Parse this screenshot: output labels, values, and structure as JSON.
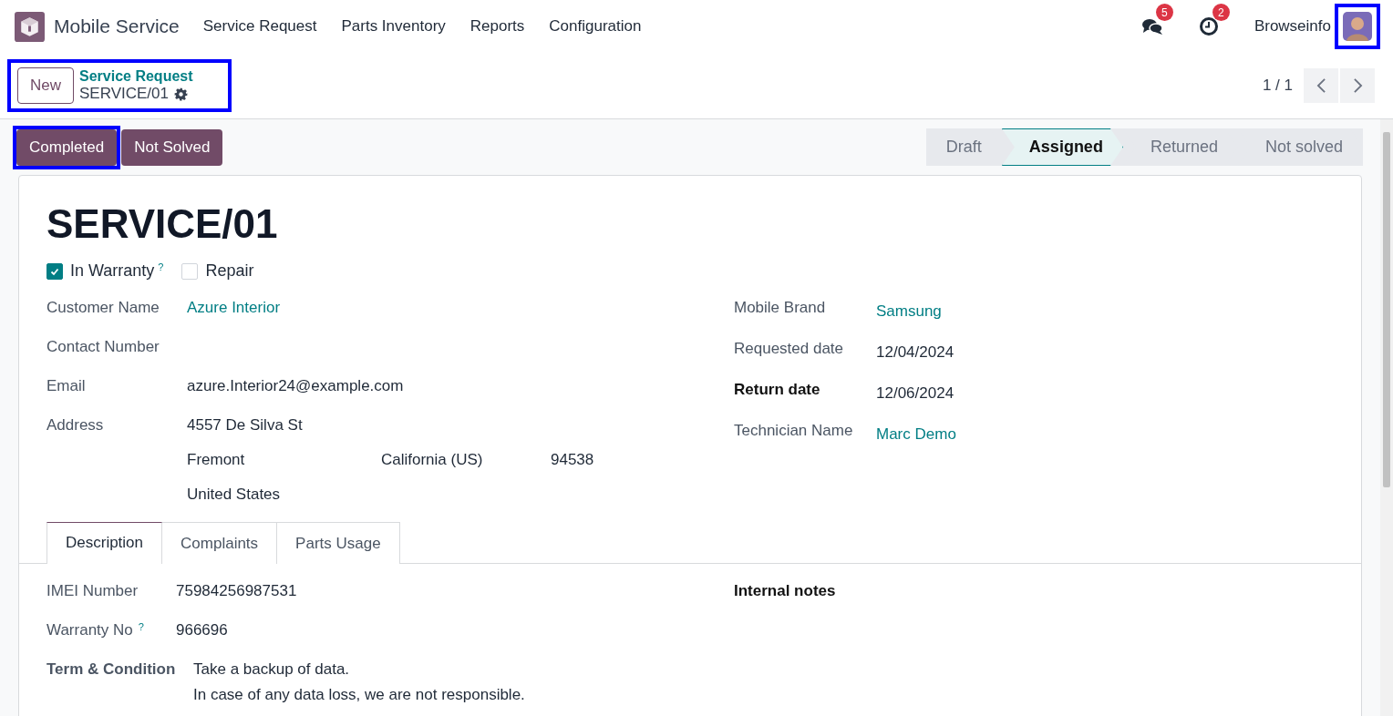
{
  "navbar": {
    "app_name": "Mobile Service",
    "menu": [
      "Service Request",
      "Parts Inventory",
      "Reports",
      "Configuration"
    ],
    "systray": [
      {
        "kind": "messages",
        "badge": "5"
      },
      {
        "kind": "activities",
        "badge": "2"
      }
    ],
    "company": "Browseinfo",
    "avatar": {
      "highlighted": true
    }
  },
  "control_panel": {
    "new_button": "New",
    "breadcrumb": "Service Request",
    "record": "SERVICE/01",
    "highlighted": true,
    "pager": "1 / 1"
  },
  "actions": [
    {
      "label": "Completed",
      "highlighted": true
    },
    {
      "label": "Not Solved",
      "highlighted": false
    }
  ],
  "status_bar": [
    {
      "label": "Draft",
      "selected": false
    },
    {
      "label": "Assigned",
      "selected": true
    },
    {
      "label": "Returned",
      "selected": false
    },
    {
      "label": "Not solved",
      "selected": false
    }
  ],
  "form": {
    "title": "SERVICE/01",
    "checkboxes": [
      {
        "label": "In Warranty",
        "checked": true,
        "help": "?"
      },
      {
        "label": "Repair",
        "checked": false
      }
    ],
    "left_fields": [
      {
        "label": "Customer Name",
        "kind": "link",
        "required": false,
        "value": "Azure Interior"
      },
      {
        "label": "Contact Number",
        "kind": "text",
        "required": false
      },
      {
        "label": "Email",
        "kind": "text",
        "required": false,
        "value": "azure.Interior24@example.com"
      },
      {
        "label": "Address",
        "kind": "address",
        "required": false,
        "lines": [
          [
            "4557 De Silva St"
          ],
          [
            "Fremont",
            "California (US)",
            "94538"
          ],
          [
            "United States"
          ]
        ]
      }
    ],
    "right_fields": [
      {
        "label": "Mobile Brand",
        "kind": "link",
        "required": false,
        "value": "Samsung"
      },
      {
        "label": "Requested date",
        "kind": "text",
        "required": false,
        "value": "12/04/2024"
      },
      {
        "label": "Return date",
        "kind": "text",
        "required": true,
        "value": "12/06/2024"
      },
      {
        "label": "Technician Name",
        "kind": "link",
        "required": false,
        "value": "Marc Demo"
      }
    ],
    "tabs": [
      {
        "label": "Description",
        "selected": true
      },
      {
        "label": "Complaints",
        "selected": false
      },
      {
        "label": "Parts Usage",
        "selected": false
      }
    ],
    "tab_left": [
      {
        "label": "IMEI Number",
        "kind": "text",
        "required": false,
        "value": "75984256987531"
      },
      {
        "label": "Warranty No",
        "kind": "text",
        "required": false,
        "help": "?",
        "value": "966696"
      },
      {
        "label": "Term & Condition",
        "kind": "lines",
        "required": true,
        "lines": [
          "Take a backup of data.",
          "In case of any data loss, we are not responsible."
        ]
      }
    ],
    "tab_right": [
      {
        "label": "Internal notes",
        "required": true
      }
    ]
  }
}
